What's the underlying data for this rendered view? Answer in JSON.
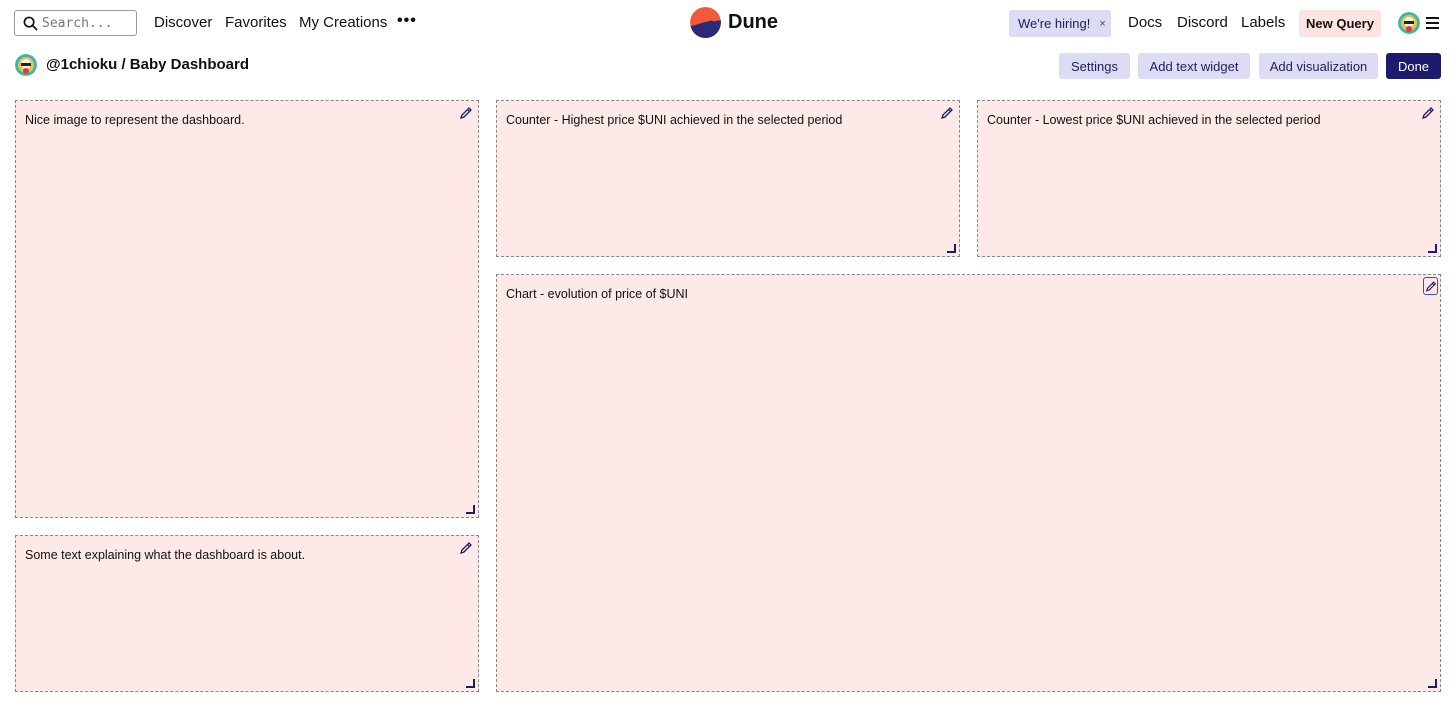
{
  "nav": {
    "search_placeholder": "Search...",
    "links": [
      "Discover",
      "Favorites",
      "My Creations"
    ],
    "more": "•••",
    "brand": "Dune",
    "hiring": "We're hiring!",
    "hiring_close": "×",
    "right_links": [
      "Docs",
      "Discord",
      "Labels"
    ],
    "new_query": "New Query"
  },
  "dashboard": {
    "breadcrumb": "@1chioku / Baby Dashboard",
    "buttons": {
      "settings": "Settings",
      "add_text_widget": "Add text widget",
      "add_visualization": "Add visualization",
      "done": "Done"
    }
  },
  "widgets": [
    {
      "text": "Nice image to represent the dashboard."
    },
    {
      "text": "Counter - Highest price $UNI achieved in the selected period"
    },
    {
      "text": "Counter - Lowest price $UNI achieved in the selected period"
    },
    {
      "text": "Chart - evolution of price of $UNI"
    },
    {
      "text": "Some text explaining what the dashboard is about."
    }
  ],
  "colors": {
    "widget_bg": "#fde9e8",
    "accent": "#1e1a6e",
    "button_bg": "#dcdcf5",
    "logo_orange": "#f15a3a"
  }
}
